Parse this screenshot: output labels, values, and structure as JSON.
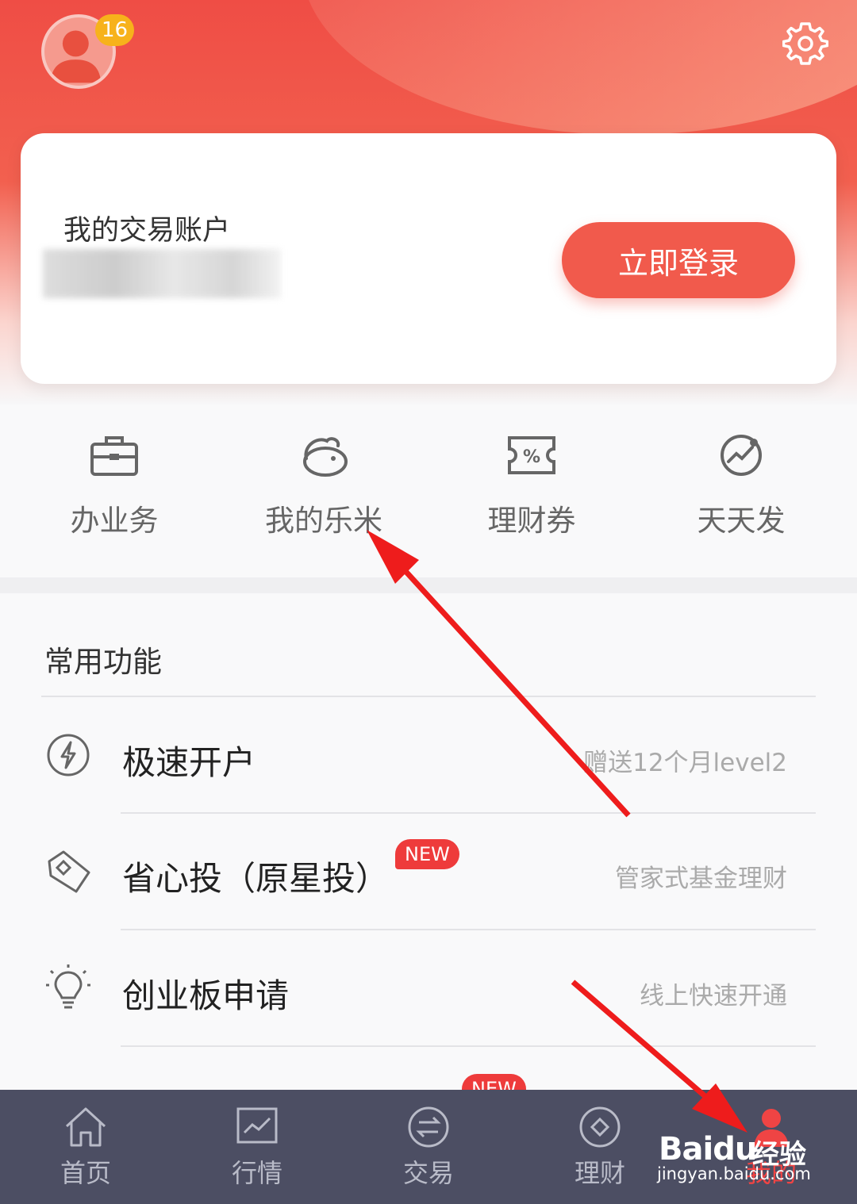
{
  "header": {
    "notification_count": "16",
    "accent": "#ef4d45"
  },
  "account_card": {
    "title": "我的交易账户",
    "login_label": "立即登录"
  },
  "quick_actions": [
    {
      "label": "办业务",
      "icon": "briefcase-icon"
    },
    {
      "label": "我的乐米",
      "icon": "bean-icon"
    },
    {
      "label": "理财券",
      "icon": "coupon-icon"
    },
    {
      "label": "天天发",
      "icon": "chart-check-icon"
    }
  ],
  "common_functions": {
    "title": "常用功能",
    "items": [
      {
        "title": "极速开户",
        "desc": "赠送12个月level2",
        "icon": "lightning-icon",
        "tag": ""
      },
      {
        "title": "省心投（原星投）",
        "desc": "管家式基金理财",
        "icon": "tag-icon",
        "tag": "NEW"
      },
      {
        "title": "创业板申请",
        "desc": "线上快速开通",
        "icon": "lightbulb-icon",
        "tag": ""
      },
      {
        "title": "",
        "desc": "",
        "icon": "",
        "tag": "NEW"
      }
    ]
  },
  "tabbar": {
    "tabs": [
      {
        "label": "首页",
        "icon": "home-icon"
      },
      {
        "label": "行情",
        "icon": "market-chart-icon"
      },
      {
        "label": "交易",
        "icon": "exchange-icon"
      },
      {
        "label": "理财",
        "icon": "diamond-icon"
      },
      {
        "label": "我的",
        "icon": "user-icon",
        "active": true
      }
    ]
  },
  "watermark": {
    "logo": "Baidu",
    "logo_cn": "经验",
    "url": "jingyan.baidu.com"
  }
}
